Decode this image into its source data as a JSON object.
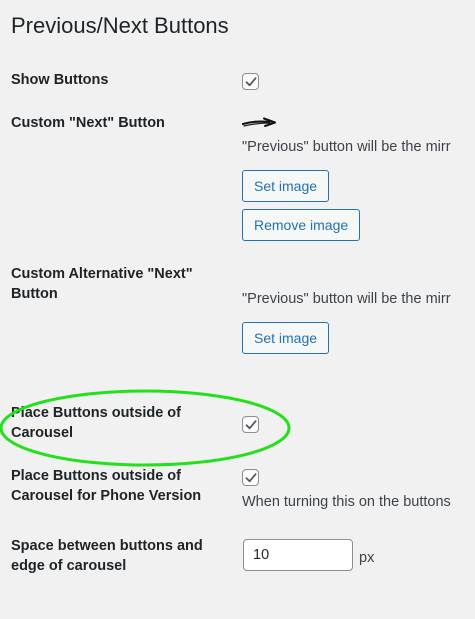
{
  "section_title": "Previous/Next Buttons",
  "colors": {
    "accent": "#2271b1",
    "highlight": "#22e01a",
    "background": "#f1f1f1"
  },
  "rows": {
    "show_buttons": {
      "label": "Show Buttons",
      "checked": true
    },
    "custom_next": {
      "label": "Custom \"Next\" Button",
      "image_icon": "arrow-image-icon",
      "description": "\"Previous\" button will be the mirr",
      "set_image": "Set image",
      "remove_image": "Remove image"
    },
    "custom_alt_next": {
      "label": "Custom Alternative \"Next\" Button",
      "description": "\"Previous\" button will be the mirr",
      "set_image": "Set image"
    },
    "outside_carousel": {
      "label": "Place Buttons outside of Carousel",
      "checked": true
    },
    "outside_carousel_phone": {
      "label": "Place Buttons outside of Carousel for Phone Version",
      "checked": true,
      "description": "When turning this on the buttons"
    },
    "space_between": {
      "label": "Space between buttons and edge of carousel",
      "value": "10",
      "unit": "px"
    }
  }
}
